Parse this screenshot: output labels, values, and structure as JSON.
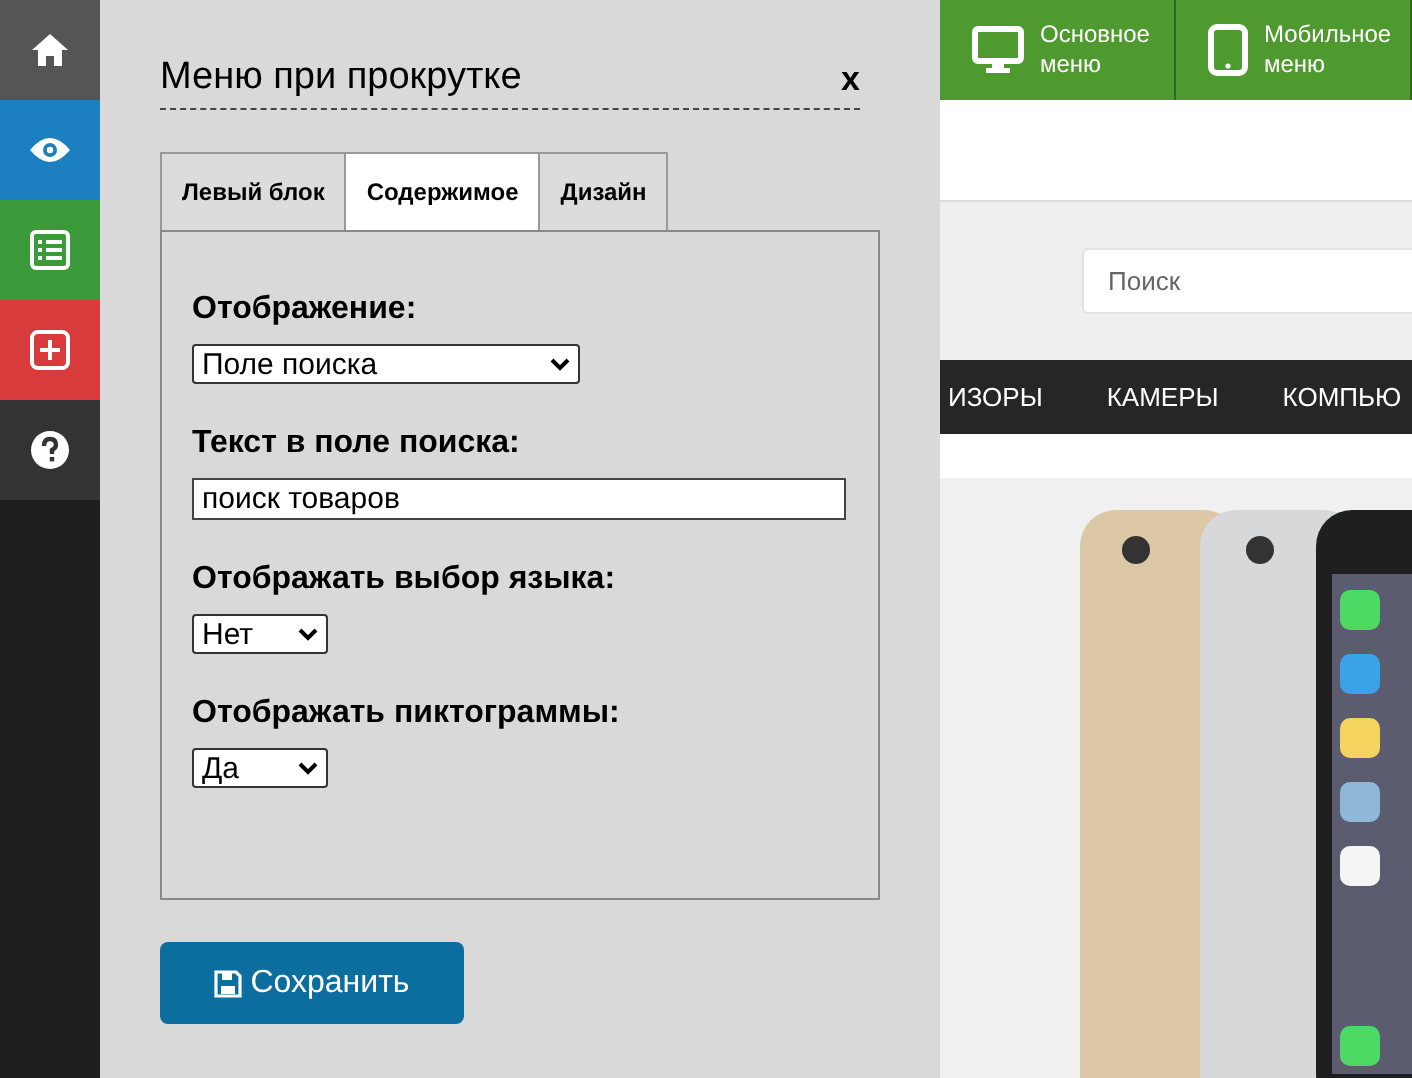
{
  "sidebar": {
    "items": [
      {
        "kind": "home",
        "color": "#555555"
      },
      {
        "kind": "eye",
        "color": "#1c7fc0"
      },
      {
        "kind": "list",
        "color": "#3b9b3b"
      },
      {
        "kind": "plus",
        "color": "#d83b3b"
      },
      {
        "kind": "help",
        "color": "#333333"
      }
    ]
  },
  "toolbar": [
    {
      "kind": "monitor",
      "lines": [
        "Основное",
        "меню"
      ]
    },
    {
      "kind": "tablet",
      "lines": [
        "Мобильное",
        "меню"
      ]
    }
  ],
  "site": {
    "search": {
      "placeholder": "Поиск"
    },
    "nav": [
      "ИЗОРЫ",
      "КАМЕРЫ",
      "КОМПЬЮ"
    ]
  },
  "dialog": {
    "title": "Меню при прокрутке",
    "close": "x",
    "tabs": [
      {
        "label": "Левый блок",
        "selected": false
      },
      {
        "label": "Содержимое",
        "selected": true
      },
      {
        "label": "Дизайн",
        "selected": false
      }
    ],
    "fields": [
      {
        "kind": "select",
        "label": "Отображение:",
        "value": "Поле поиска",
        "wide": true
      },
      {
        "kind": "text",
        "label": "Текст в поле поиска:",
        "value": "поиск товаров"
      },
      {
        "kind": "select",
        "label": "Отображать выбор языка:",
        "value": "Нет",
        "wide": false
      },
      {
        "kind": "select",
        "label": "Отображать пиктограммы:",
        "value": "Да",
        "wide": false
      }
    ],
    "save": "Сохранить"
  }
}
